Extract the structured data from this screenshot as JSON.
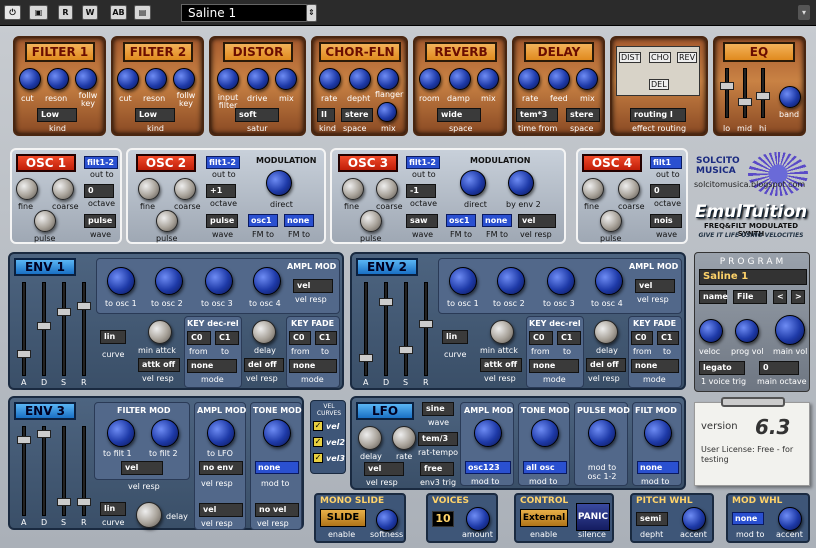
{
  "toolbar": {
    "b1": "⏻",
    "b2": "▣",
    "r": "R",
    "w": "W",
    "ab": "AB",
    "b6": "▤",
    "preset": "Saline 1",
    "arrow": "▾"
  },
  "fx": {
    "filter1": {
      "title": "FILTER 1",
      "cut": "cut",
      "reson": "reson",
      "follow": "follw key",
      "kind_val": "Low",
      "kind": "kind"
    },
    "filter2": {
      "title": "FILTER 2",
      "cut": "cut",
      "reson": "reson",
      "follow": "follw key",
      "kind_val": "Low",
      "kind": "kind"
    },
    "distor": {
      "title": "DISTOR",
      "input": "input filter",
      "drive": "drive",
      "mix": "mix",
      "satur_val": "soft",
      "satur": "satur"
    },
    "chor": {
      "title": "CHOR-FLN",
      "rate": "rate",
      "depth": "depht",
      "flanger": "flanger",
      "kind_val": "II",
      "kind": "kind",
      "space_val": "stere",
      "space": "space",
      "mix": "mix"
    },
    "reverb": {
      "title": "REVERB",
      "room": "room",
      "damp": "damp",
      "mix": "mix",
      "space_val": "wide",
      "space": "space"
    },
    "delay": {
      "title": "DELAY",
      "rate": "rate",
      "feed": "feed",
      "mix": "mix",
      "time_val": "tem*3",
      "time": "time from",
      "space_val": "stere",
      "space": "space"
    },
    "routing": {
      "dist": "DIST",
      "cho": "CHO",
      "rev": "REV",
      "del": "DEL",
      "val": "routing I",
      "label": "effect routing"
    },
    "eq": {
      "title": "EQ",
      "lo": "lo",
      "mid": "mid",
      "hi": "hi",
      "band": "band"
    }
  },
  "osc1": {
    "title": "OSC 1",
    "fine": "fine",
    "coarse": "coarse",
    "pulse": "pulse",
    "out_val": "filt1-2",
    "out": "out to",
    "oct_val": "0",
    "oct": "octave",
    "wave_val": "pulse",
    "wave": "wave"
  },
  "osc2": {
    "title": "OSC 2",
    "fine": "fine",
    "coarse": "coarse",
    "pulse": "pulse",
    "out_val": "filt1-2",
    "out": "out to",
    "oct_val": "+1",
    "oct": "octave",
    "wave_val": "pulse",
    "wave": "wave",
    "mod": "MODULATION",
    "direct": "direct",
    "fm_val": "osc1",
    "fm": "FM to",
    "fm2_val": "none",
    "fm2": "FM to"
  },
  "osc3": {
    "title": "OSC 3",
    "fine": "fine",
    "coarse": "coarse",
    "pulse": "pulse",
    "out_val": "filt1-2",
    "out": "out to",
    "oct_val": "-1",
    "oct": "octave",
    "wave_val": "saw",
    "wave": "wave",
    "mod": "MODULATION",
    "direct": "direct",
    "byenv": "by env 2",
    "fm_val": "osc1",
    "fm": "FM to",
    "fm2_val": "none",
    "fm2": "FM to",
    "vr_val": "vel",
    "vr": "vel resp"
  },
  "osc4": {
    "title": "OSC 4",
    "fine": "fine",
    "coarse": "coarse",
    "pulse": "pulse",
    "out_val": "filt1",
    "out": "out to",
    "oct_val": "0",
    "oct": "octave",
    "wave_val": "nois",
    "wave": "wave"
  },
  "logo": {
    "brand": "SOLCITO MUSICA",
    "url": "solcitomusica.blogspot.com",
    "name": "EmulTuition",
    "tag1": "FREQ&FILT MODULATED SYNTH",
    "tag2": "GIVE IT LIFE USING VELOCITIES"
  },
  "env1": {
    "title": "ENV 1",
    "a": "A",
    "d": "D",
    "s": "S",
    "r": "R",
    "ampl": "AMPL MOD",
    "t1": "to osc 1",
    "t2": "to osc 2",
    "t3": "to osc 3",
    "t4": "to osc 4",
    "vr_val": "vel",
    "vr": "vel resp",
    "curve_val": "lin",
    "curve": "curve",
    "minatk": "min attck",
    "atk_val": "attk off",
    "atk": "vel resp",
    "keydec": "KEY dec-rel",
    "c0": "C0",
    "c1": "C1",
    "from": "from",
    "to": "to",
    "mode_val": "none",
    "mode": "mode",
    "delay": "delay",
    "del_val": "del off",
    "delvr": "vel resp",
    "keyfade": "KEY FADE",
    "f0": "C0",
    "f1": "C1",
    "kfrom": "from",
    "kto": "to",
    "kmode_val": "none",
    "kmode": "mode"
  },
  "env2": {
    "title": "ENV 2",
    "a": "A",
    "d": "D",
    "s": "S",
    "r": "R",
    "ampl": "AMPL MOD",
    "t1": "to osc 1",
    "t2": "to osc 2",
    "t3": "to osc 3",
    "t4": "to osc 4",
    "vr_val": "vel",
    "vr": "vel resp",
    "curve_val": "lin",
    "curve": "curve",
    "minatk": "min attck",
    "atk_val": "attk off",
    "atk": "vel resp",
    "keydec": "KEY dec-rel",
    "c0": "C0",
    "c1": "C1",
    "from": "from",
    "to": "to",
    "mode_val": "none",
    "mode": "mode",
    "delay": "delay",
    "del_val": "del off",
    "delvr": "vel resp",
    "keyfade": "KEY FADE",
    "f0": "C0",
    "f1": "C1",
    "kfrom": "from",
    "kto": "to",
    "kmode_val": "none",
    "kmode": "mode"
  },
  "program": {
    "title": "PROGRAM",
    "name_val": "Saline 1",
    "name": "name",
    "file": "File",
    "prev": "<",
    "next": ">",
    "veloc": "veloc",
    "progvol": "prog vol",
    "mainvol": "main vol",
    "trig_val": "legato",
    "trig": "1 voice trig",
    "oct_val": "0",
    "oct": "main octave"
  },
  "env3": {
    "title": "ENV 3",
    "a": "A",
    "d": "D",
    "s": "S",
    "r": "R",
    "curve_val": "lin",
    "curve": "curve",
    "filt": "FILTER MOD",
    "tf1": "to filt 1",
    "tf2": "to filt 2",
    "vr_val": "vel",
    "vr": "vel resp",
    "delay": "delay",
    "ampl": "AMPL MOD",
    "tolfo": "to LFO",
    "noenv_val": "no env",
    "envvr": "vel resp",
    "vr2_val": "vel",
    "vr2": "vel resp",
    "tone": "TONE MOD",
    "tone_val": "none",
    "toneto": "mod to",
    "nov_val": "no vel",
    "novr": "vel resp"
  },
  "velcurves": {
    "title": "VEL CURVES",
    "v1": "vel",
    "v2": "vel2",
    "v3": "vel3"
  },
  "lfo": {
    "title": "LFO",
    "wave_val": "sine",
    "wave": "wave",
    "tempo_val": "tem/3",
    "tempo": "rat-tempo",
    "trig_val": "free",
    "trig": "env3 trig",
    "delay": "delay",
    "rate": "rate",
    "vr_val": "vel",
    "vr": "vel resp",
    "ampl": "AMPL MOD",
    "a_val": "osc123",
    "a": "mod to",
    "tone": "TONE MOD",
    "t_val": "all osc",
    "t": "mod to",
    "pulse": "PULSE MOD",
    "p": "mod to osc 1-2",
    "filt": "FILT MOD",
    "f_val": "none",
    "f": "mod to"
  },
  "version": {
    "label": "version",
    "num": "6.3",
    "lic": "User License: Free - for testing"
  },
  "bottom": {
    "mono": "MONO SLIDE",
    "slide": "SLIDE",
    "enable": "enable",
    "soft": "softness",
    "voices": "VOICES",
    "vnum": "10",
    "amount": "amount",
    "control": "CONTROL",
    "ext": "External",
    "cen": "enable",
    "panic": "PANIC",
    "silence": "silence",
    "pitch": "PITCH WHL",
    "semi_val": "semi",
    "depht": "depht",
    "accent": "accent",
    "modwhl": "MOD WHL",
    "none_val": "none",
    "modto": "mod to",
    "accent2": "accent"
  }
}
